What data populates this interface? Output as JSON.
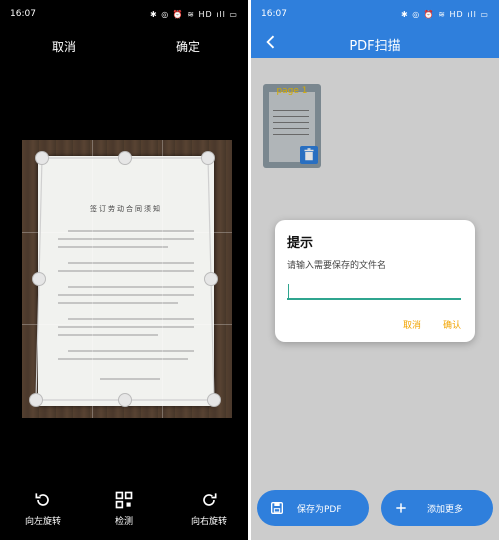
{
  "left": {
    "status": {
      "time": "16:07",
      "icons": "✱ ◎ ⏰ ≋ HD ıll ▭"
    },
    "top": {
      "cancel": "取消",
      "confirm": "确定"
    },
    "document_title": "签订劳动合同须知",
    "bottom": {
      "rotate_left": "向左旋转",
      "detect": "检测",
      "rotate_right": "向右旋转"
    }
  },
  "right": {
    "status": {
      "time": "16:07",
      "icons": "✱ ◎ ⏰ ≋ HD ıll ▭"
    },
    "title": "PDF扫描",
    "thumbnail": {
      "label": "page 1"
    },
    "dialog": {
      "title": "提示",
      "message": "请输入需要保存的文件名",
      "input_value": "",
      "cancel": "取消",
      "confirm": "确认"
    },
    "buttons": {
      "save_pdf": "保存为PDF",
      "add_more": "添加更多"
    }
  },
  "colors": {
    "accent": "#2f7fdc",
    "dialog_action": "#f2a400",
    "input_underline": "#2fa58f"
  }
}
